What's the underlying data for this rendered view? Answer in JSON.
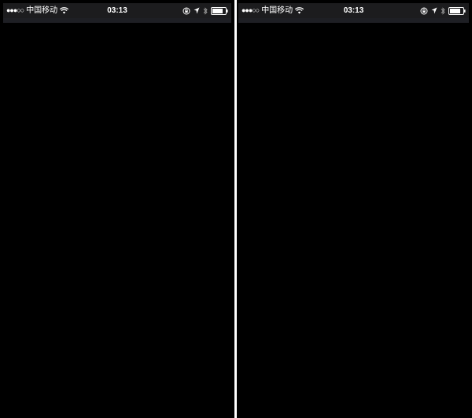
{
  "screens": [
    {
      "status_bar": {
        "signal": "●●●○○",
        "carrier": "中国移动",
        "time": "03:13"
      }
    },
    {
      "status_bar": {
        "signal": "●●●○○",
        "carrier": "中国移动",
        "time": "03:13"
      }
    }
  ],
  "icons": {
    "wifi": "wifi-icon",
    "orientation_lock": "orientation-lock-icon",
    "location": "location-arrow-icon",
    "bluetooth": "bluetooth-icon",
    "battery": "battery-icon"
  },
  "colors": {
    "screen_background": "#000000",
    "status_bar_background": "#1c1c1e",
    "status_text": "#ffffff"
  }
}
